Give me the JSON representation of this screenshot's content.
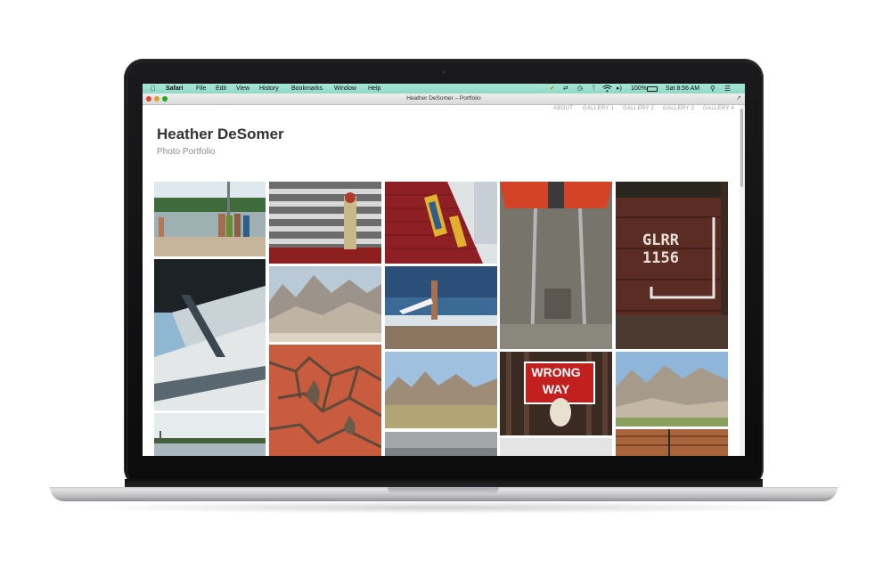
{
  "menubar": {
    "app_name": "Safari",
    "items": [
      "File",
      "Edit",
      "View",
      "History",
      "Bookmarks",
      "Window",
      "Help"
    ],
    "battery": "100%",
    "clock": "Sat 8:56 AM"
  },
  "window": {
    "title": "Heather DeSomer – Portfolio"
  },
  "site": {
    "nav": [
      "ABOUT",
      "GALLERY 1",
      "GALLERY 2",
      "GALLERY 3",
      "GALLERY 4"
    ],
    "title": "Heather DeSomer",
    "subtitle": "Photo Portfolio"
  },
  "photos": {
    "wrong_way_sign_line1": "WRONG",
    "wrong_way_sign_line2": "WAY",
    "railcar_marking_line1": "GLRR",
    "railcar_marking_line2": "1156"
  },
  "colors": {
    "menubar": "#a7e6d5",
    "title_text": "#333333",
    "subtitle_text": "#8c8c8c",
    "nav_text": "#9a9a9a"
  }
}
